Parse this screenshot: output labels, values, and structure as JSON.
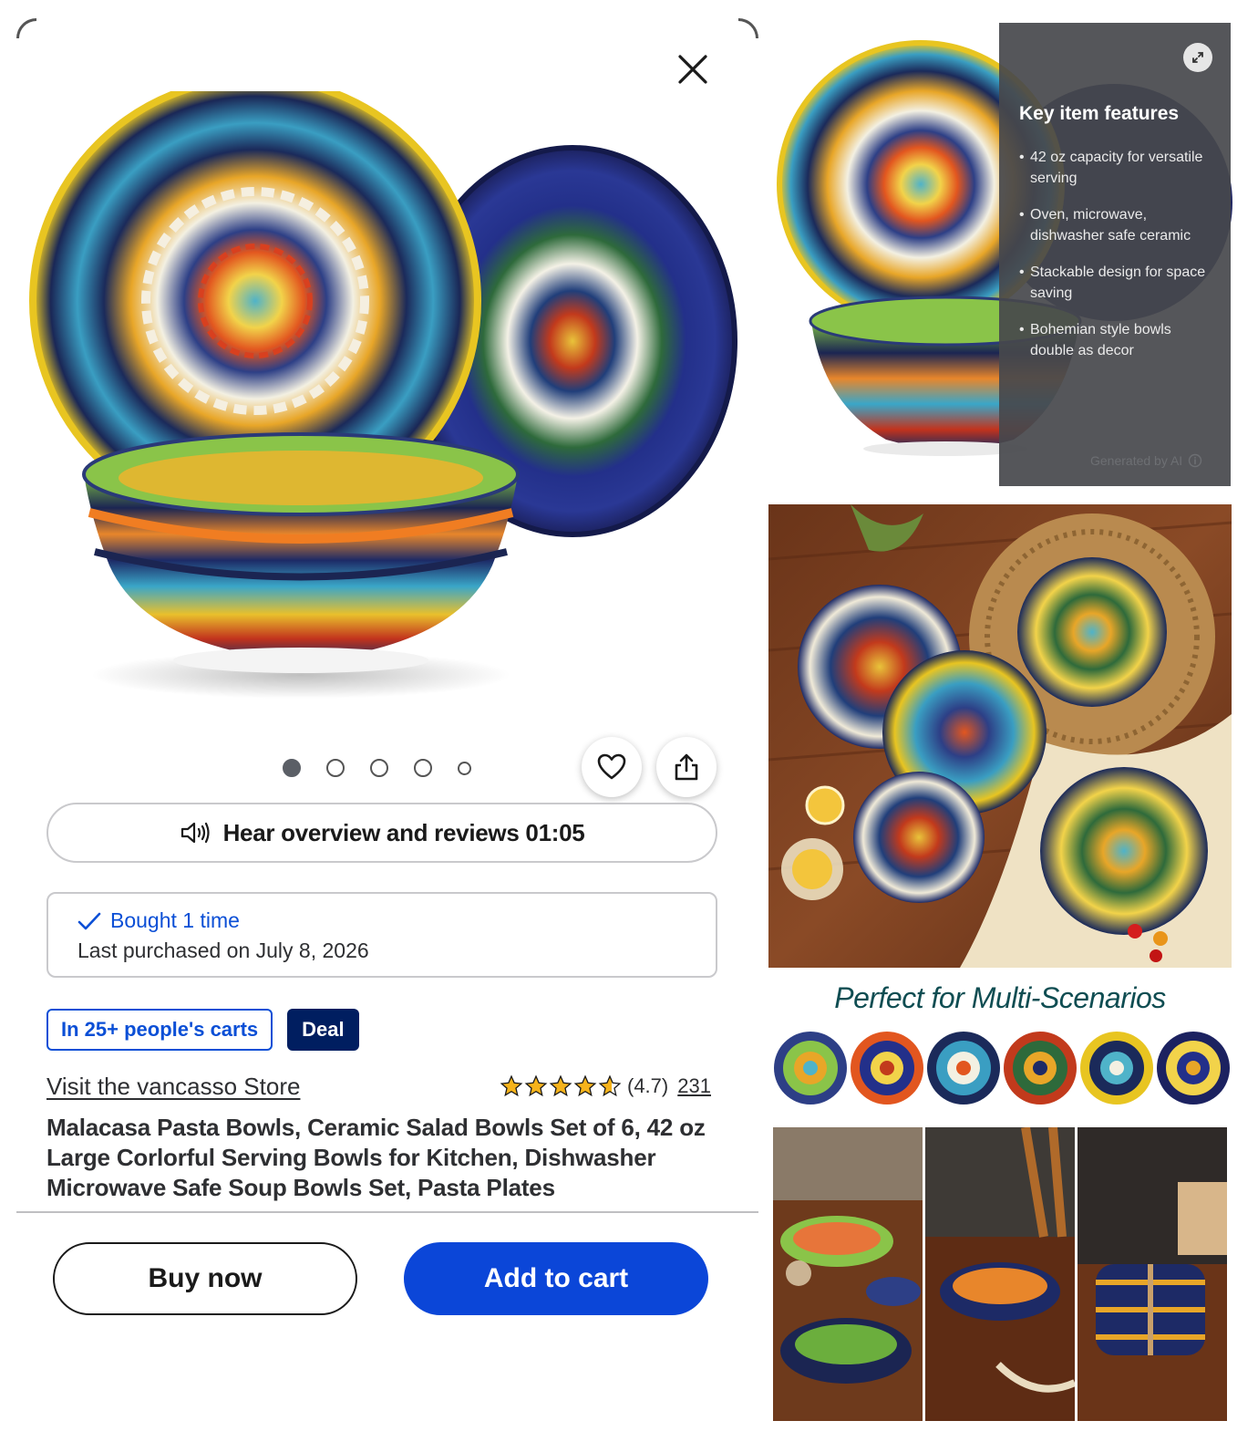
{
  "product_modal": {
    "close_label": "Close",
    "carousel": {
      "total": 5,
      "active_index": 0
    },
    "audio": {
      "label": "Hear overview and reviews 01:05"
    },
    "purchase_history": {
      "bought_text": "Bought 1 time",
      "last_purchased": "Last purchased on July 8, 2026"
    },
    "badges": [
      "In 25+ people's carts",
      "Deal"
    ],
    "store_link": "Visit the vancasso Store",
    "rating": {
      "value": 4.7,
      "display": "(4.7)",
      "review_count": "231"
    },
    "title": "Malacasa Pasta Bowls, Ceramic Salad Bowls Set of 6, 42 oz Large Corlorful Serving Bowls for Kitchen, Dishwasher Microwave Safe Soup Bowls Set, Pasta Plates",
    "actions": {
      "buy_now": "Buy now",
      "add_to_cart": "Add to cart"
    }
  },
  "key_features": {
    "title": "Key item features",
    "items": [
      "42 oz capacity for versatile serving",
      "Oven, microwave, dishwasher safe ceramic",
      "Stackable design for space saving",
      "Bohemian style bowls double as decor"
    ],
    "footnote": "Generated by AI"
  },
  "gallery": {
    "scenarios_title": "Perfect for Multi-Scenarios"
  },
  "icons": {
    "close": "close-icon",
    "heart": "heart-icon",
    "share": "share-icon",
    "speaker": "speaker-icon",
    "check": "check-icon",
    "star": "star-icon",
    "expand": "expand-icon",
    "info": "info-icon"
  },
  "colors": {
    "accent_blue": "#0b46d8",
    "deal_navy": "#001e60",
    "star_gold": "#f6b31b",
    "scenario_teal": "#0f4d52"
  }
}
